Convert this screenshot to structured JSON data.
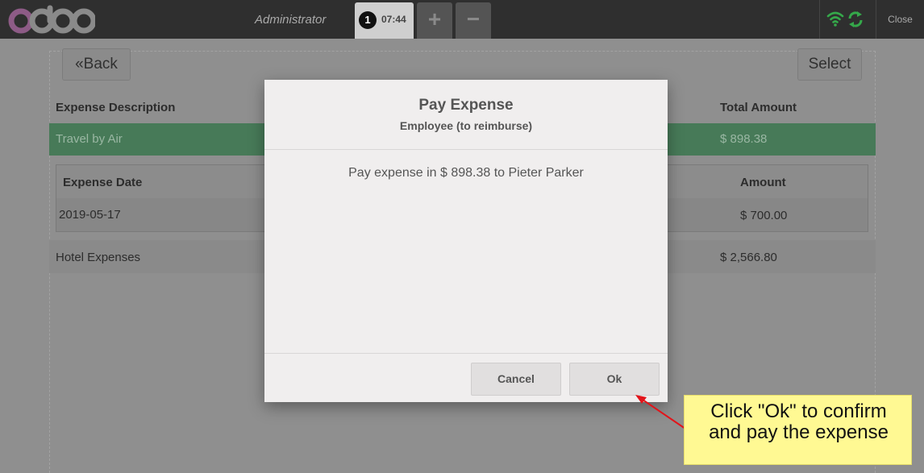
{
  "topbar": {
    "logo": "odoo",
    "user": "Administrator",
    "order_number": "1",
    "order_time": "07:44",
    "add_order": "+",
    "remove_order": "−",
    "close_label": "Close",
    "status_icons": [
      "wifi-icon",
      "sync-icon"
    ],
    "status_color": "#35a84a"
  },
  "background": {
    "back_label": "Back",
    "back_icon": "«",
    "select_label": "Select",
    "headers": {
      "description": "Expense Description",
      "total": "Total Amount"
    },
    "selected_row": {
      "description": "Travel by Air",
      "total": "$ 898.38",
      "color": "#477a58"
    },
    "sub_table": {
      "headers": {
        "date": "Expense Date",
        "amount": "Amount"
      },
      "row": {
        "date": "2019-05-17",
        "amount": "$ 700.00"
      }
    },
    "second_row": {
      "description": "Hotel Expenses",
      "total": "$ 2,566.80"
    }
  },
  "modal": {
    "title": "Pay Expense",
    "subtitle": "Employee (to reimburse)",
    "body": "Pay expense in $ 898.38 to Pieter Parker",
    "cancel_label": "Cancel",
    "ok_label": "Ok"
  },
  "annotation": {
    "text": "Click \"Ok\" to confirm\nand pay the expense",
    "arrow_color": "#e2141a",
    "background": "#fff993"
  }
}
